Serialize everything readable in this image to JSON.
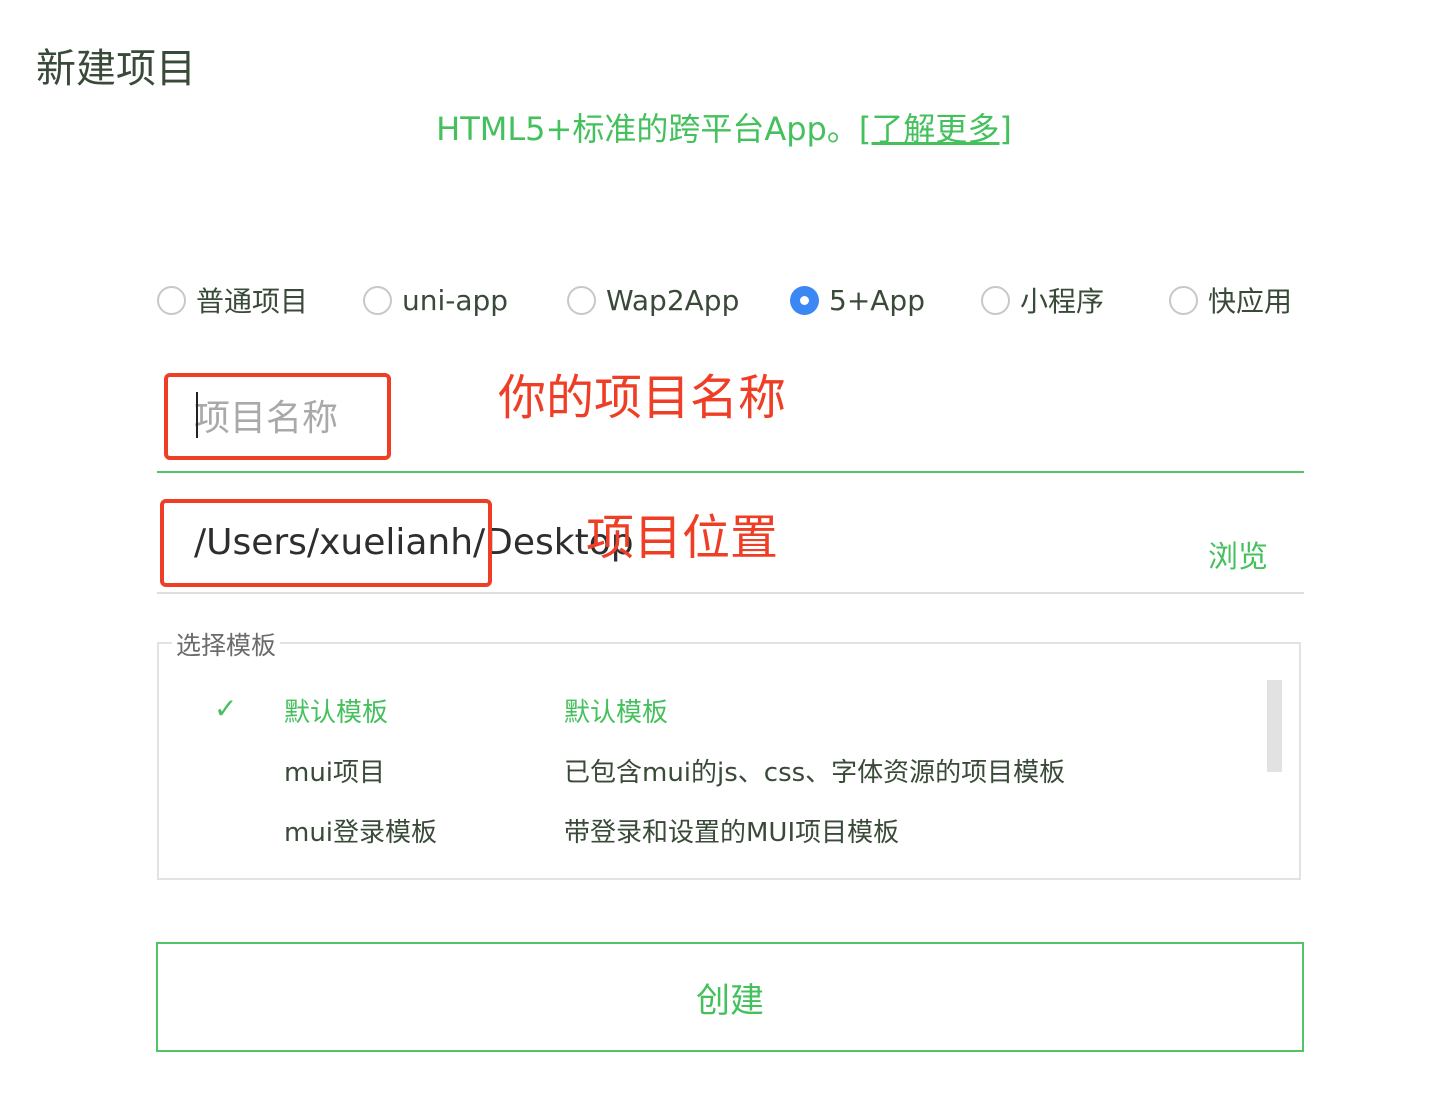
{
  "title": "新建项目",
  "subtitle": {
    "text": "HTML5+标准的跨平台App。",
    "link": "[了解更多]"
  },
  "project_types": [
    {
      "label": "普通项目",
      "checked": false
    },
    {
      "label": "uni-app",
      "checked": false
    },
    {
      "label": "Wap2App",
      "checked": false
    },
    {
      "label": "5+App",
      "checked": true
    },
    {
      "label": "小程序",
      "checked": false
    },
    {
      "label": "快应用",
      "checked": false
    }
  ],
  "project_name": {
    "value": "",
    "placeholder": "项目名称"
  },
  "project_path": {
    "value": "/Users/xuelianh/Desktop",
    "browse_label": "浏览"
  },
  "templates": {
    "legend": "选择模板",
    "items": [
      {
        "name": "默认模板",
        "description": "默认模板",
        "selected": true,
        "check": "✓"
      },
      {
        "name": "mui项目",
        "description": "已包含mui的js、css、字体资源的项目模板",
        "selected": false
      },
      {
        "name": "mui登录模板",
        "description": "带登录和设置的MUI项目模板",
        "selected": false
      }
    ]
  },
  "create_button": "创建",
  "annotations": {
    "name_note": "你的项目名称",
    "path_note": "项目位置"
  },
  "colors": {
    "accent_green": "#44c05c",
    "annotation_red": "#ef3e26",
    "radio_blue": "#3b87f3"
  }
}
